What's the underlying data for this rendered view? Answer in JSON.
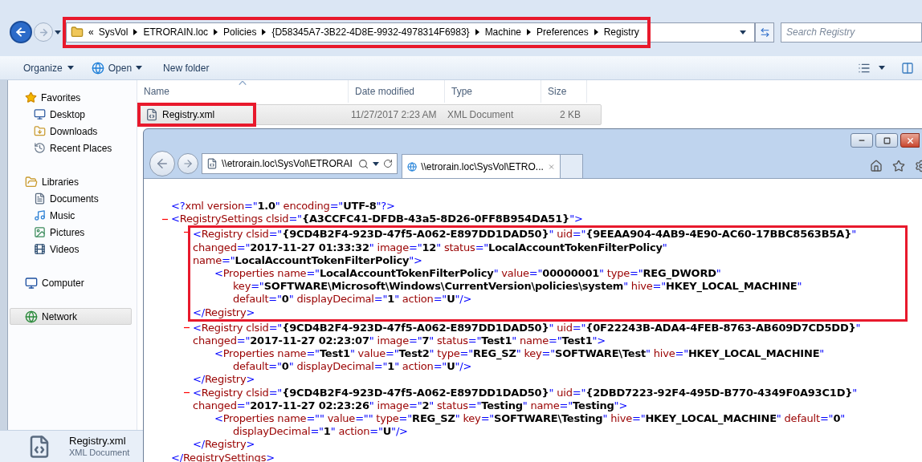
{
  "explorer": {
    "address_bar": {
      "highlighted": true,
      "overflow": "«",
      "crumbs": [
        "SysVol",
        "ETRORAIN.loc",
        "Policies",
        "{D58345A7-3B22-4D8E-9932-4978314F6983}",
        "Machine",
        "Preferences",
        "Registry"
      ]
    },
    "search": {
      "placeholder": "Search Registry"
    },
    "toolbar": [
      {
        "label": "Organize",
        "kind": "menu"
      },
      {
        "label": "Open",
        "kind": "open"
      },
      {
        "label": "New folder",
        "kind": "plain"
      }
    ],
    "navigation": [
      {
        "label": "Favorites",
        "selected": false,
        "children": [
          {
            "label": "Desktop",
            "selected": false
          },
          {
            "label": "Downloads",
            "selected": false
          },
          {
            "label": "Recent Places",
            "selected": false
          }
        ]
      },
      {
        "label": "Libraries",
        "selected": false,
        "children": [
          {
            "label": "Documents",
            "selected": false
          },
          {
            "label": "Music",
            "selected": false
          },
          {
            "label": "Pictures",
            "selected": false
          },
          {
            "label": "Videos",
            "selected": false
          }
        ]
      },
      {
        "label": "Computer",
        "selected": false
      },
      {
        "label": "Network",
        "selected": true
      }
    ],
    "columns": [
      {
        "label": "Name",
        "sorted": true
      },
      {
        "label": "Date modified",
        "sorted": false
      },
      {
        "label": "Type",
        "sorted": false
      },
      {
        "label": "Size",
        "sorted": false
      }
    ],
    "files": [
      {
        "cells": [
          "Registry.xml",
          "11/27/2017 2:23 AM",
          "XML Document",
          "2 KB"
        ],
        "selected": true,
        "highlighted": true
      }
    ],
    "details": {
      "name": "Registry.xml",
      "type": "XML Document"
    }
  },
  "browser": {
    "address": "\\\\etrorain.loc\\SysVol\\ETRORAI",
    "tabs": [
      {
        "title": "\\\\etrorain.loc\\SysVol\\ETRO...",
        "selected": true
      }
    ],
    "xml": {
      "declaration": "<?xml version=\"1.0\" encoding=\"UTF-8\"?>",
      "root": {
        "expanded": true,
        "highlighted": false,
        "open": [
          "<RegistrySettings clsid=\"{A3CCFC41-DFDB-43a5-8D26-0FF8B954DA51}\">"
        ],
        "close": "</RegistrySettings>",
        "children": [
          {
            "expanded": true,
            "highlighted": true,
            "open": [
              "<Registry clsid=\"{9CD4B2F4-923D-47f5-A062-E897DD1DAD50}\" uid=\"{9EEAA904-4AB9-4E90-AC60-17BBC8563B5A}\"",
              "changed=\"2017-11-27 01:33:32\" image=\"12\" status=\"LocalAccountTokenFilterPolicy\"",
              "name=\"LocalAccountTokenFilterPolicy\">"
            ],
            "close": "</Registry>",
            "children": [
              {
                "highlighted": false,
                "open": [
                  "<Properties name=\"LocalAccountTokenFilterPolicy\" value=\"00000001\" type=\"REG_DWORD\"",
                  "key=\"SOFTWARE\\Microsoft\\Windows\\CurrentVersion\\policies\\system\" hive=\"HKEY_LOCAL_MACHINE\"",
                  "default=\"0\" displayDecimal=\"1\" action=\"U\"/>"
                ]
              }
            ]
          },
          {
            "expanded": true,
            "highlighted": false,
            "open": [
              "<Registry clsid=\"{9CD4B2F4-923D-47f5-A062-E897DD1DAD50}\" uid=\"{0F22243B-ADA4-4FEB-8763-AB609D7CD5DD}\"",
              "changed=\"2017-11-27 02:23:07\" image=\"7\" status=\"Test1\" name=\"Test1\">"
            ],
            "close": "</Registry>",
            "children": [
              {
                "highlighted": false,
                "open": [
                  "<Properties name=\"Test1\" value=\"Test2\" type=\"REG_SZ\" key=\"SOFTWARE\\Test\" hive=\"HKEY_LOCAL_MACHINE\"",
                  "default=\"0\" displayDecimal=\"1\" action=\"U\"/>"
                ]
              }
            ]
          },
          {
            "expanded": true,
            "highlighted": false,
            "open": [
              "<Registry clsid=\"{9CD4B2F4-923D-47f5-A062-E897DD1DAD50}\" uid=\"{2DBD7223-92F4-495D-B770-4349F0A93C1D}\"",
              "changed=\"2017-11-27 02:23:26\" image=\"2\" status=\"Testing\" name=\"Testing\">"
            ],
            "close": "</Registry>",
            "children": [
              {
                "highlighted": false,
                "open": [
                  "<Properties name=\"\" value=\"\" type=\"REG_SZ\" key=\"SOFTWARE\\Testing\" hive=\"HKEY_LOCAL_MACHINE\" default=\"0\"",
                  "displayDecimal=\"1\" action=\"U\"/>"
                ]
              }
            ]
          }
        ]
      }
    }
  }
}
